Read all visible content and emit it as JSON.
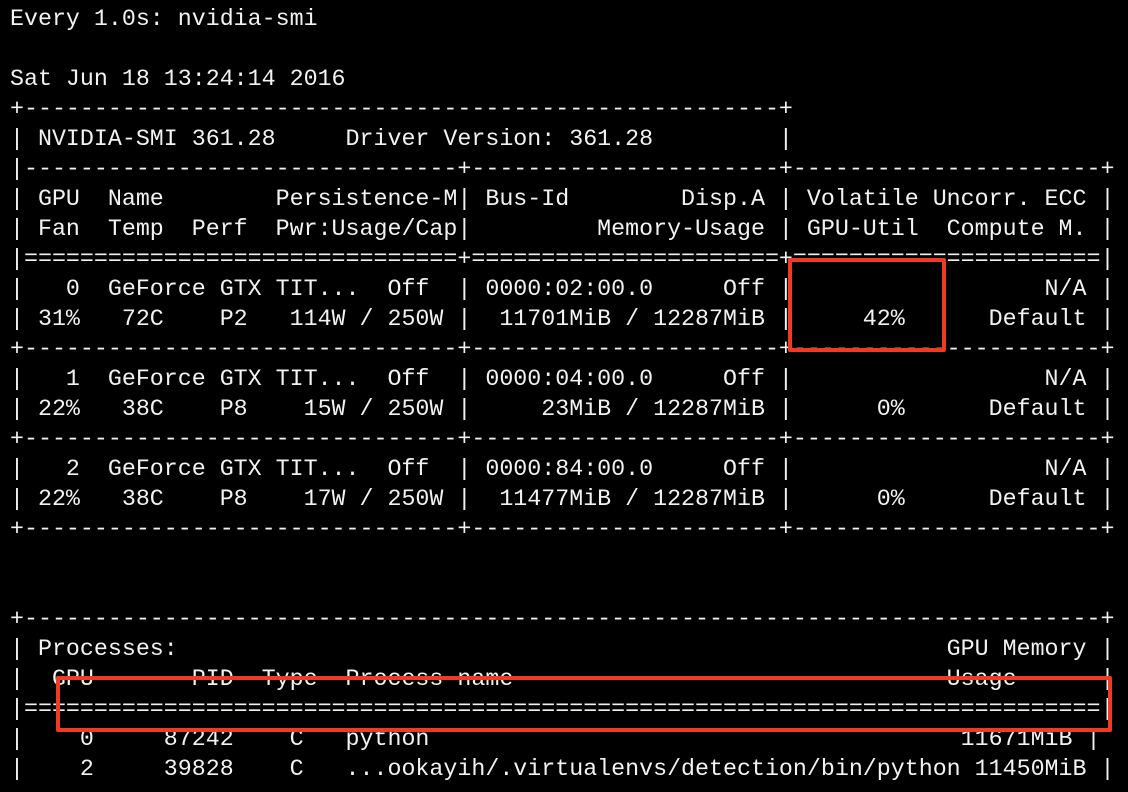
{
  "terminal": {
    "lines": [
      "Every 1.0s: nvidia-smi",
      "",
      "Sat Jun 18 13:24:14 2016",
      "+------------------------------------------------------+",
      "| NVIDIA-SMI 361.28     Driver Version: 361.28         |",
      "|-------------------------------+----------------------+----------------------+",
      "| GPU  Name        Persistence-M| Bus-Id        Disp.A | Volatile Uncorr. ECC |",
      "| Fan  Temp  Perf  Pwr:Usage/Cap|         Memory-Usage | GPU-Util  Compute M. |",
      "|===============================+======================+======================|",
      "|   0  GeForce GTX TIT...  Off  | 0000:02:00.0     Off |                  N/A |",
      "| 31%   72C    P2   114W / 250W |  11701MiB / 12287MiB |     42%      Default |",
      "+-------------------------------+----------------------+----------------------+",
      "|   1  GeForce GTX TIT...  Off  | 0000:04:00.0     Off |                  N/A |",
      "| 22%   38C    P8    15W / 250W |     23MiB / 12287MiB |      0%      Default |",
      "+-------------------------------+----------------------+----------------------+",
      "|   2  GeForce GTX TIT...  Off  | 0000:84:00.0     Off |                  N/A |",
      "| 22%   38C    P8    17W / 250W |  11477MiB / 12287MiB |      0%      Default |",
      "+-------------------------------+----------------------+----------------------+",
      "",
      "",
      "+-----------------------------------------------------------------------------+",
      "| Processes:                                                       GPU Memory |",
      "|  GPU       PID  Type  Process name                               Usage      |",
      "|=============================================================================|",
      "|    0     87242    C   python                                      11671MiB |",
      "|    2     39828    C   ...ookayih/.virtualenvs/detection/bin/python 11450MiB |",
      "+-----------------------------------------------------------------------------+"
    ]
  },
  "annotations": {
    "highlight_color": "#ef3b24"
  }
}
